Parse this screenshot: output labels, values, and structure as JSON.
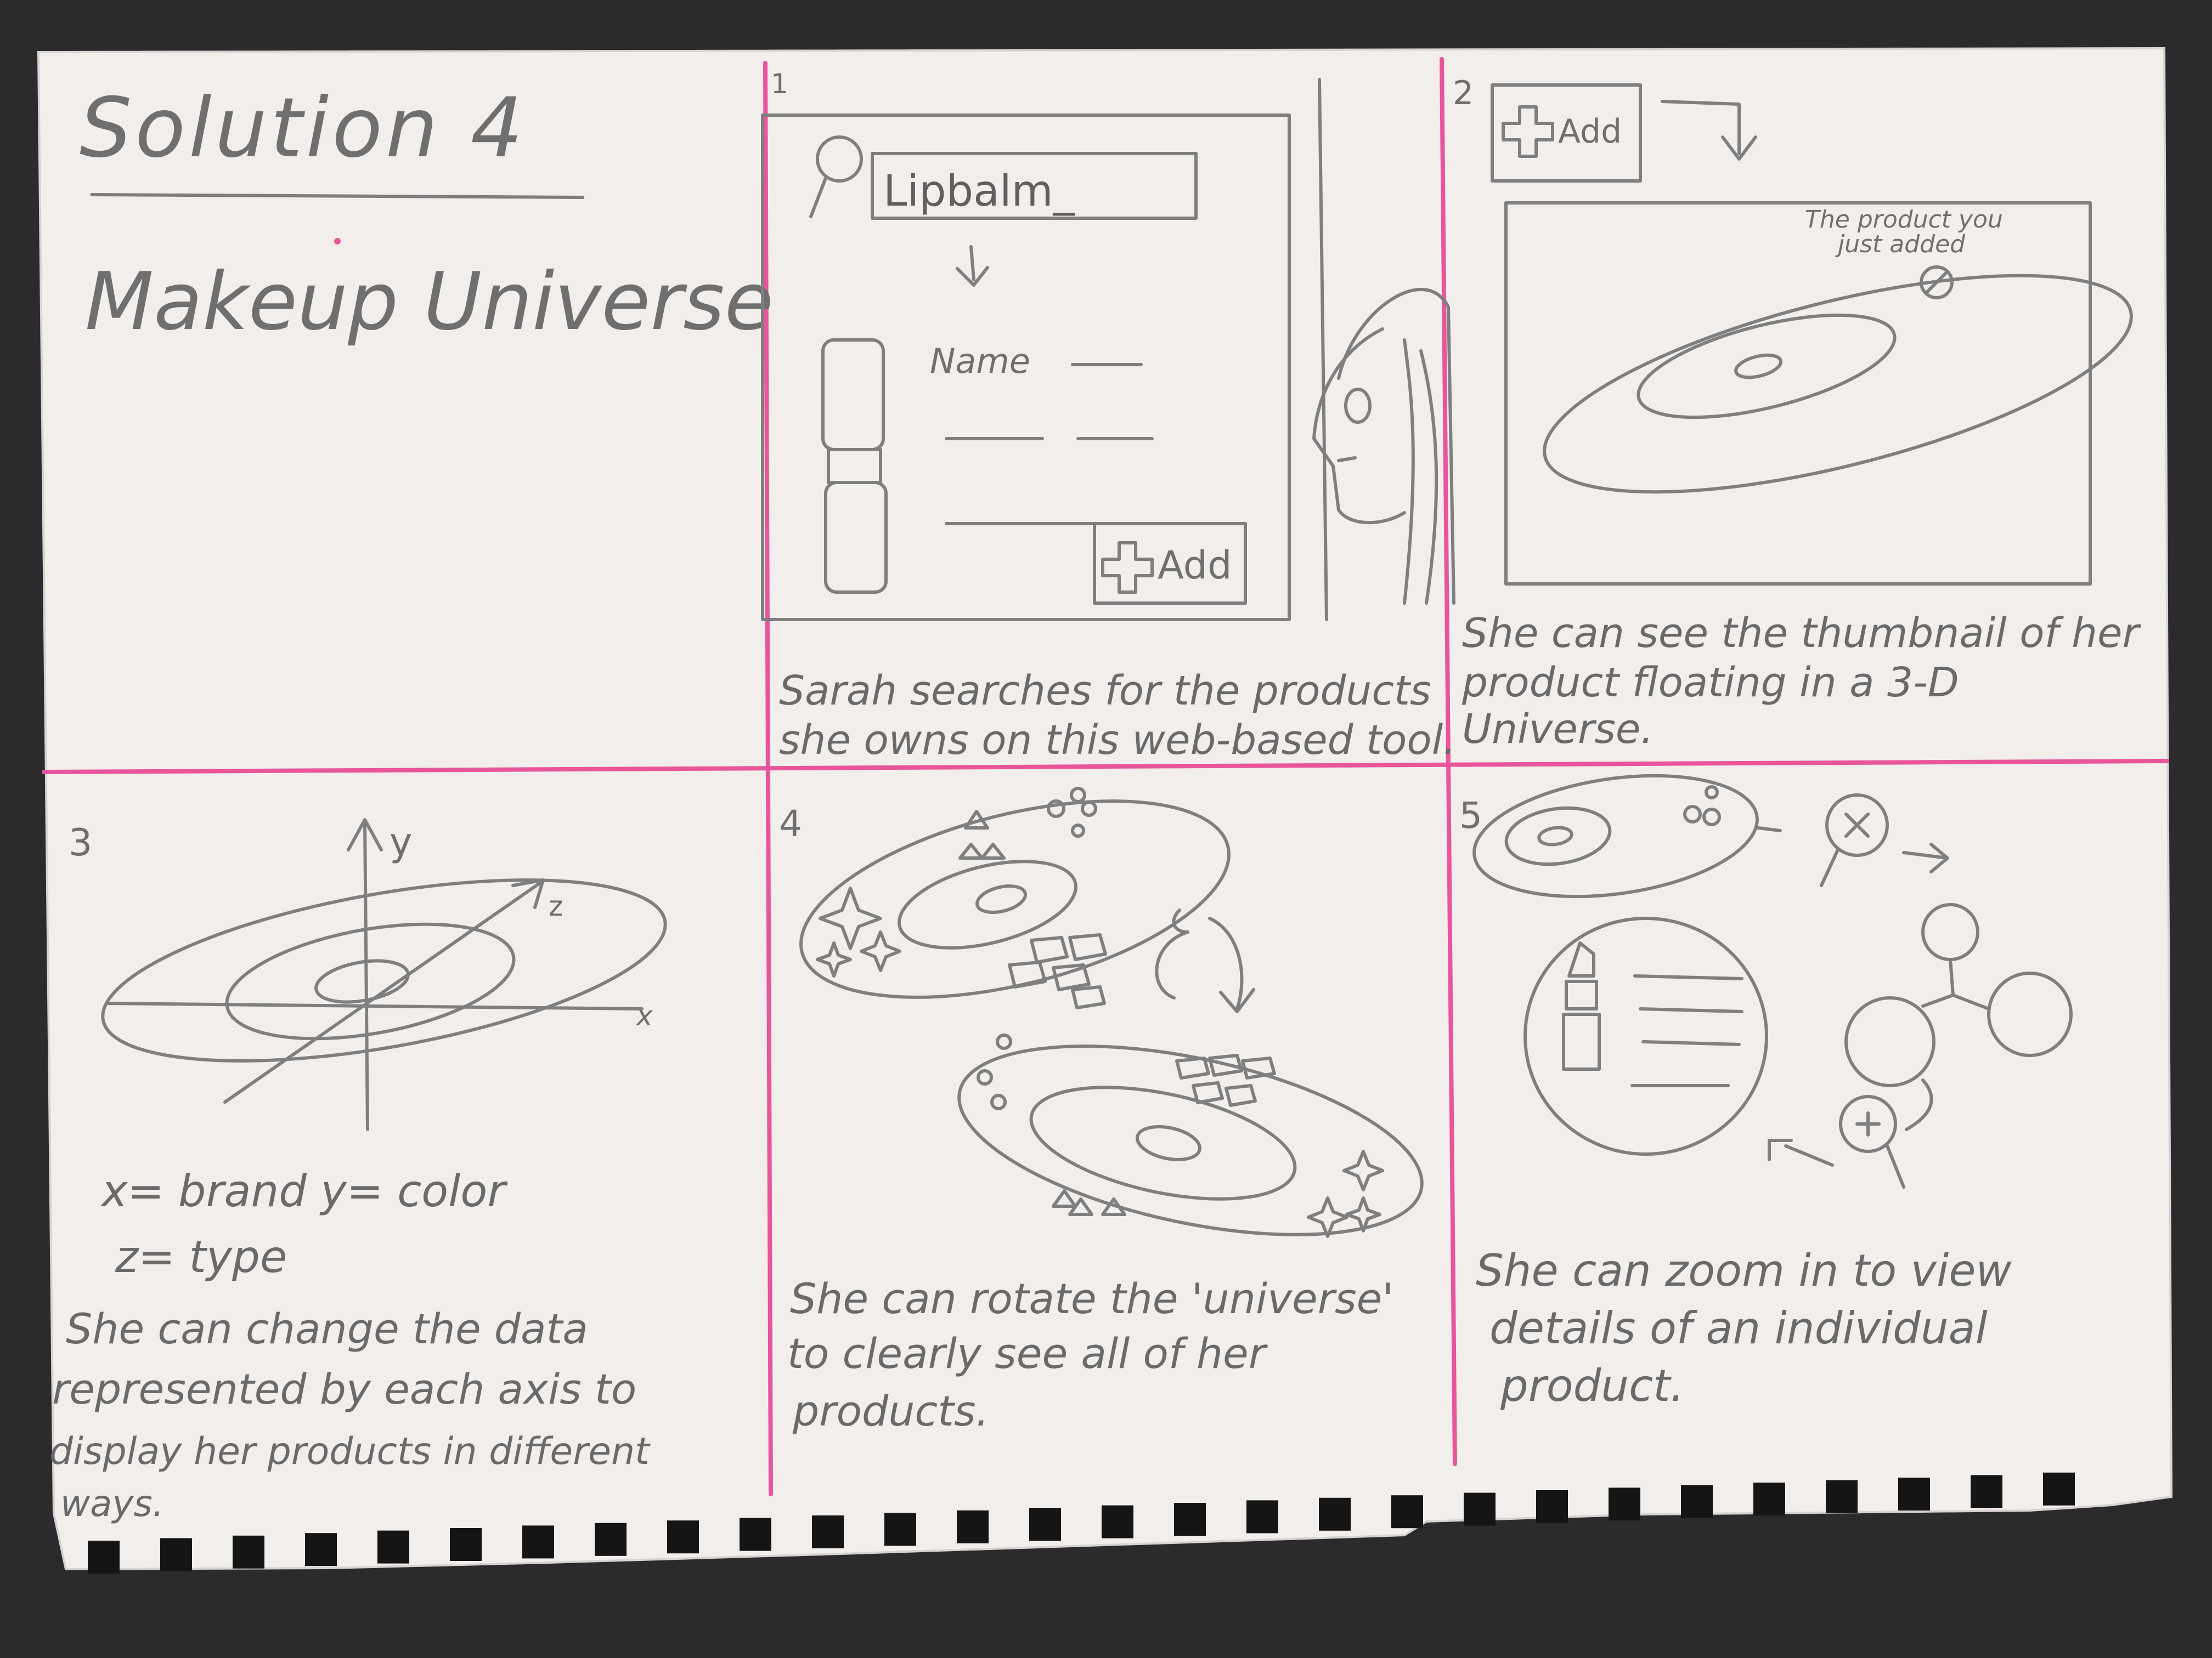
{
  "title": "Solution 4",
  "subtitle": "Makeup Universe",
  "colors": {
    "background": "#2b2b2d",
    "paper": "#f1eeec",
    "grid_line": "#e8559a",
    "pencil": "#7d7d7d",
    "hole": "#151515"
  },
  "panel1": {
    "number": "1",
    "search_value": "Lipbalm_",
    "name_label": "Name",
    "add_label": "Add",
    "caption_line1": "Sarah searches for the products",
    "caption_line2": "she owns on this web-based tool."
  },
  "panel2": {
    "number": "2",
    "add_label": "Add",
    "annotation_line1": "The product you",
    "annotation_line2": "just added",
    "caption_line1": "She can see the thumbnail of her",
    "caption_line2": "product floating in a 3-D",
    "caption_line3": "Universe."
  },
  "panel3": {
    "number": "3",
    "axis_y": "y",
    "axis_z": "z",
    "axis_x": "x",
    "mapping_line1": "x= brand  y= color",
    "mapping_line2": "z= type",
    "caption_line1": "She can change the data",
    "caption_line2": "represented by each axis to",
    "caption_line3": "display her products in different",
    "caption_line4": "ways."
  },
  "panel4": {
    "number": "4",
    "caption_line1": "She can rotate the 'universe'",
    "caption_line2": "to clearly see all of her",
    "caption_line3": "products."
  },
  "panel5": {
    "number": "5",
    "caption_line1": "She can zoom in to view",
    "caption_line2": "details of an individual",
    "caption_line3": "product."
  },
  "icons": [
    "magnifier-icon",
    "plus-icon",
    "zoom-in-icon",
    "lipstick-icon",
    "sparkle-icon",
    "rotate-arrow-icon"
  ]
}
